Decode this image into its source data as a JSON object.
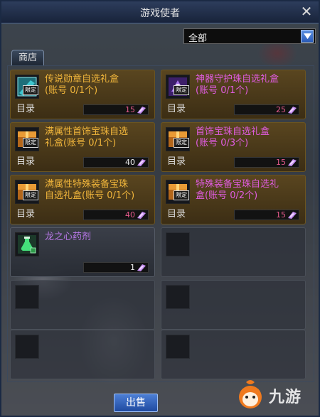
{
  "window": {
    "title": "游戏使者"
  },
  "filter": {
    "selected": "全部"
  },
  "tabs": [
    {
      "label": "商店"
    }
  ],
  "items": [
    {
      "name": "传说勋章自选礼盒\n(账号 0/1个)",
      "catalog": "目录",
      "price": "15",
      "name_color": "yellow",
      "icon": "teal-gift-box-icon",
      "badge": "限定"
    },
    {
      "name": "神器守护珠自选礼盒\n(账号 0/1个)",
      "catalog": "目录",
      "price": "25",
      "name_color": "magenta",
      "icon": "purple-gift-box-icon",
      "badge": "限定"
    },
    {
      "name": "满属性首饰宝珠自选\n礼盒(账号 0/1个)",
      "catalog": "目录",
      "price": "40",
      "name_color": "yellow",
      "icon": "gold-gift-box-icon",
      "badge": "限定"
    },
    {
      "name": "首饰宝珠自选礼盒\n(账号 0/3个)",
      "catalog": "目录",
      "price": "15",
      "name_color": "magenta",
      "icon": "gold-gift-box-icon",
      "badge": "限定"
    },
    {
      "name": "满属性特殊装备宝珠\n自选礼盒(账号 0/1个)",
      "catalog": "目录",
      "price": "40",
      "name_color": "yellow",
      "icon": "gold-gift-box-icon",
      "badge": "限定"
    },
    {
      "name": "特殊装备宝珠自选礼\n盒(账号 0/2个)",
      "catalog": "目录",
      "price": "15",
      "name_color": "magenta",
      "icon": "gold-gift-box-icon",
      "badge": "限定"
    },
    {
      "name": "龙之心药剂",
      "catalog": "",
      "price": "1",
      "name_color": "green",
      "icon": "green-potion-icon",
      "badge": ""
    }
  ],
  "actions": {
    "sell_label": "出售"
  },
  "watermark": {
    "text": "九游"
  },
  "colors": {
    "yellow_name": "#f0b53b",
    "magenta_name": "#e05ce0",
    "price_pink": "#e65a8c",
    "accent_blue": "#2a5bb8"
  }
}
